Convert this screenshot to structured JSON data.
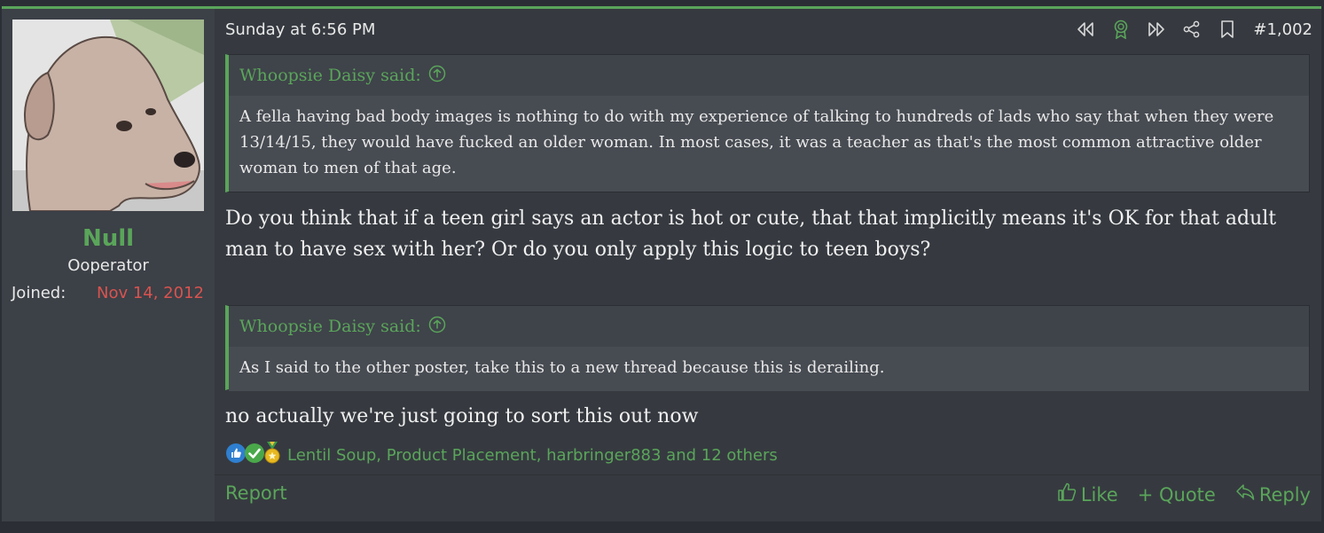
{
  "post": {
    "date": "Sunday at 6:56 PM",
    "number": "#1,002",
    "actions_icons": [
      "rewind-icon",
      "award-icon",
      "fast-forward-icon",
      "share-icon",
      "bookmark-icon"
    ]
  },
  "user": {
    "name": "Null",
    "title": "Ooperator",
    "joined_label": "Joined:",
    "joined_value": "Nov 14, 2012"
  },
  "quotes": [
    {
      "author": "Whoopsie Daisy said:",
      "text": "A fella having bad body images is nothing to do with my experience of talking to hundreds of lads who say that when they were 13/14/15, they would have fucked an older woman. In most cases, it was a teacher as that's the most common attractive older woman to men of that age."
    },
    {
      "author": "Whoopsie Daisy said:",
      "text": "As I said to the other poster, take this to a new thread because this is derailing."
    }
  ],
  "replies": [
    "Do you think that if a teen girl says an actor is hot or cute, that that implicitly means it's OK for that adult man to have sex with her? Or do you only apply this logic to teen boys?",
    "no actually we're just going to sort this out now"
  ],
  "reactions": {
    "icons": [
      "thumbs-up-icon",
      "checkmark-icon",
      "medal-icon"
    ],
    "list": "Lentil Soup, Product Placement, harbringer883 and 12 others"
  },
  "footer": {
    "report": "Report",
    "like": "Like",
    "quote": "+ Quote",
    "reply": "Reply"
  },
  "colors": {
    "accent": "#5aa55a",
    "joined": "#d9534f",
    "background": "#363a40"
  }
}
